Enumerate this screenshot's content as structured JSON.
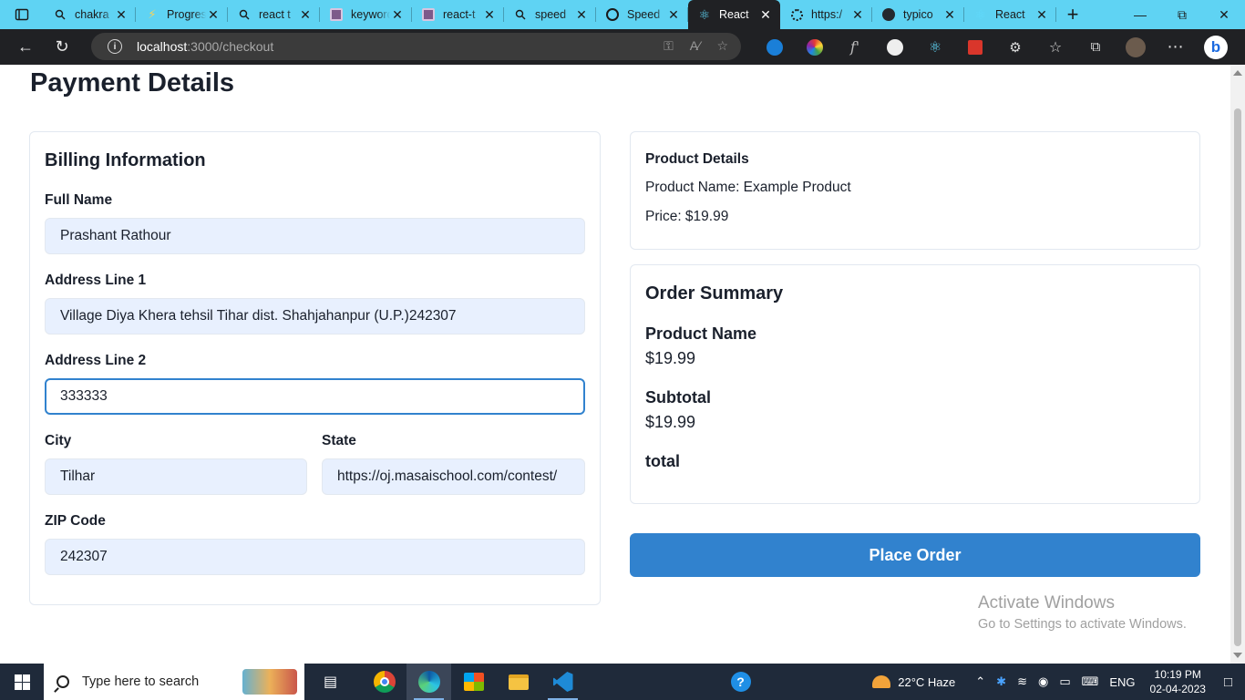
{
  "browser": {
    "tabs": [
      {
        "title": "chakra",
        "icon": "search-icon",
        "active": false
      },
      {
        "title": "Progress",
        "icon": "bolt-icon",
        "active": false
      },
      {
        "title": "react t",
        "icon": "search-icon",
        "active": false
      },
      {
        "title": "keyword",
        "icon": "book-icon",
        "active": false
      },
      {
        "title": "react-t",
        "icon": "book-icon",
        "active": false
      },
      {
        "title": "speed",
        "icon": "search-icon",
        "active": false
      },
      {
        "title": "Speed",
        "icon": "speed-icon",
        "active": false
      },
      {
        "title": "React",
        "icon": "react-icon",
        "active": true
      },
      {
        "title": "https:/",
        "icon": "loading-icon",
        "active": false
      },
      {
        "title": "typico",
        "icon": "github-icon",
        "active": false
      },
      {
        "title": "React",
        "icon": "react-icon",
        "active": false
      }
    ],
    "url_host": "localhost",
    "url_path": ":3000/checkout"
  },
  "page": {
    "title": "Payment Details",
    "billing": {
      "heading": "Billing Information",
      "full_name_label": "Full Name",
      "full_name_value": "Prashant Rathour",
      "address1_label": "Address Line 1",
      "address1_value": "Village Diya Khera tehsil Tihar dist. Shahjahanpur (U.P.)242307",
      "address2_label": "Address Line 2",
      "address2_value": "333333",
      "city_label": "City",
      "city_value": "Tilhar",
      "state_label": "State",
      "state_value": "https://oj.masaischool.com/contest/",
      "zip_label": "ZIP Code",
      "zip_value": "242307"
    },
    "product": {
      "heading": "Product Details",
      "name_line": "Product Name: Example Product",
      "price_line": "Price: $19.99"
    },
    "summary": {
      "heading": "Order Summary",
      "product_name_label": "Product Name",
      "product_price": "$19.99",
      "subtotal_label": "Subtotal",
      "subtotal_value": "$19.99",
      "total_label": "total"
    },
    "place_order_label": "Place Order"
  },
  "watermark": {
    "line1": "Activate Windows",
    "line2": "Go to Settings to activate Windows."
  },
  "taskbar": {
    "search_placeholder": "Type here to search",
    "weather": "22°C  Haze",
    "language": "ENG",
    "time": "10:19 PM",
    "date": "02-04-2023"
  }
}
